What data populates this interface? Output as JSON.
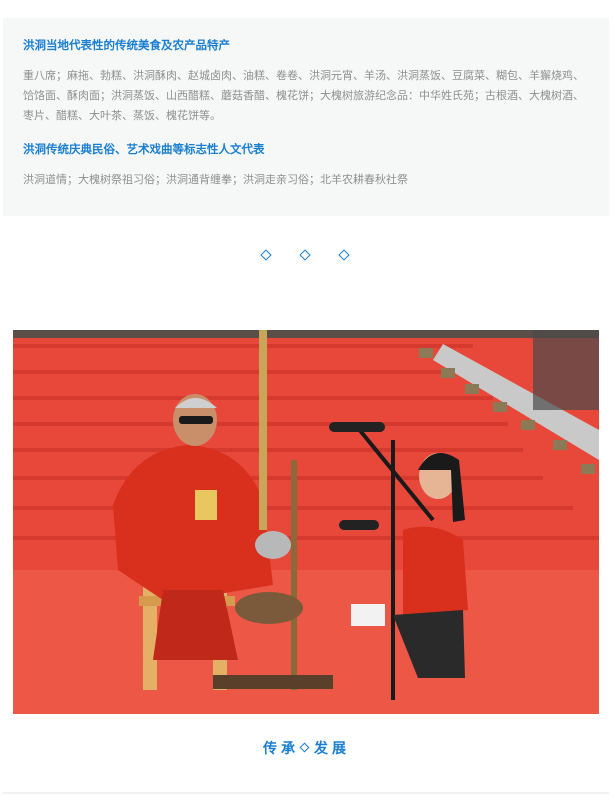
{
  "food": {
    "title": "洪洞当地代表性的传统美食及农产品特产",
    "body": "重八席；麻拖、勃糕、洪洞酥肉、赵城卤肉、油糕、卷卷、洪洞元宵、羊汤、洪洞蒸饭、豆腐菜、糊包、羊獬烧鸡、饸饹面、酥肉面；洪洞蒸饭、山西醋糕、蘑菇香醋、槐花饼；大槐树旅游纪念品：中华姓氏苑；古根酒、大槐树酒、枣片、醋糕、大叶茶、蒸饭、槐花饼等。"
  },
  "folk": {
    "title": "洪洞传统庆典民俗、艺术戏曲等标志性人文代表",
    "body": "洪洞道情；大槐树祭祖习俗；洪洞通背缠拳；洪洞走亲习俗；北羊农耕春秋社祭"
  },
  "divider": {
    "icon": "diamond-icon",
    "color": "#1a7fd1"
  },
  "photo": {
    "subject": "folk-performance-photo"
  },
  "footer": {
    "left": "传承",
    "right": "发展"
  },
  "colors": {
    "accent": "#1a7fd1",
    "card_bg": "#f6f7f7",
    "body_text": "#8f8f8f"
  }
}
